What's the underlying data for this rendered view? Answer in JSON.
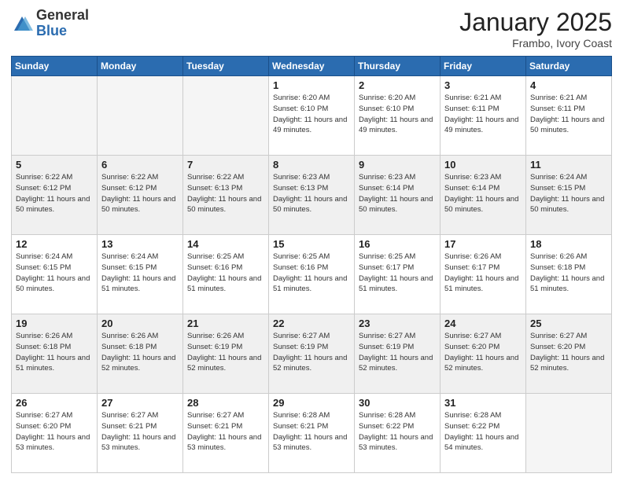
{
  "logo": {
    "general": "General",
    "blue": "Blue"
  },
  "header": {
    "month": "January 2025",
    "location": "Frambo, Ivory Coast"
  },
  "weekdays": [
    "Sunday",
    "Monday",
    "Tuesday",
    "Wednesday",
    "Thursday",
    "Friday",
    "Saturday"
  ],
  "weeks": [
    [
      {
        "day": "",
        "empty": true
      },
      {
        "day": "",
        "empty": true
      },
      {
        "day": "",
        "empty": true
      },
      {
        "day": "1",
        "sunrise": "6:20 AM",
        "sunset": "6:10 PM",
        "daylight": "11 hours and 49 minutes."
      },
      {
        "day": "2",
        "sunrise": "6:20 AM",
        "sunset": "6:10 PM",
        "daylight": "11 hours and 49 minutes."
      },
      {
        "day": "3",
        "sunrise": "6:21 AM",
        "sunset": "6:11 PM",
        "daylight": "11 hours and 49 minutes."
      },
      {
        "day": "4",
        "sunrise": "6:21 AM",
        "sunset": "6:11 PM",
        "daylight": "11 hours and 50 minutes."
      }
    ],
    [
      {
        "day": "5",
        "sunrise": "6:22 AM",
        "sunset": "6:12 PM",
        "daylight": "11 hours and 50 minutes."
      },
      {
        "day": "6",
        "sunrise": "6:22 AM",
        "sunset": "6:12 PM",
        "daylight": "11 hours and 50 minutes."
      },
      {
        "day": "7",
        "sunrise": "6:22 AM",
        "sunset": "6:13 PM",
        "daylight": "11 hours and 50 minutes."
      },
      {
        "day": "8",
        "sunrise": "6:23 AM",
        "sunset": "6:13 PM",
        "daylight": "11 hours and 50 minutes."
      },
      {
        "day": "9",
        "sunrise": "6:23 AM",
        "sunset": "6:14 PM",
        "daylight": "11 hours and 50 minutes."
      },
      {
        "day": "10",
        "sunrise": "6:23 AM",
        "sunset": "6:14 PM",
        "daylight": "11 hours and 50 minutes."
      },
      {
        "day": "11",
        "sunrise": "6:24 AM",
        "sunset": "6:15 PM",
        "daylight": "11 hours and 50 minutes."
      }
    ],
    [
      {
        "day": "12",
        "sunrise": "6:24 AM",
        "sunset": "6:15 PM",
        "daylight": "11 hours and 50 minutes."
      },
      {
        "day": "13",
        "sunrise": "6:24 AM",
        "sunset": "6:15 PM",
        "daylight": "11 hours and 51 minutes."
      },
      {
        "day": "14",
        "sunrise": "6:25 AM",
        "sunset": "6:16 PM",
        "daylight": "11 hours and 51 minutes."
      },
      {
        "day": "15",
        "sunrise": "6:25 AM",
        "sunset": "6:16 PM",
        "daylight": "11 hours and 51 minutes."
      },
      {
        "day": "16",
        "sunrise": "6:25 AM",
        "sunset": "6:17 PM",
        "daylight": "11 hours and 51 minutes."
      },
      {
        "day": "17",
        "sunrise": "6:26 AM",
        "sunset": "6:17 PM",
        "daylight": "11 hours and 51 minutes."
      },
      {
        "day": "18",
        "sunrise": "6:26 AM",
        "sunset": "6:18 PM",
        "daylight": "11 hours and 51 minutes."
      }
    ],
    [
      {
        "day": "19",
        "sunrise": "6:26 AM",
        "sunset": "6:18 PM",
        "daylight": "11 hours and 51 minutes."
      },
      {
        "day": "20",
        "sunrise": "6:26 AM",
        "sunset": "6:18 PM",
        "daylight": "11 hours and 52 minutes."
      },
      {
        "day": "21",
        "sunrise": "6:26 AM",
        "sunset": "6:19 PM",
        "daylight": "11 hours and 52 minutes."
      },
      {
        "day": "22",
        "sunrise": "6:27 AM",
        "sunset": "6:19 PM",
        "daylight": "11 hours and 52 minutes."
      },
      {
        "day": "23",
        "sunrise": "6:27 AM",
        "sunset": "6:19 PM",
        "daylight": "11 hours and 52 minutes."
      },
      {
        "day": "24",
        "sunrise": "6:27 AM",
        "sunset": "6:20 PM",
        "daylight": "11 hours and 52 minutes."
      },
      {
        "day": "25",
        "sunrise": "6:27 AM",
        "sunset": "6:20 PM",
        "daylight": "11 hours and 52 minutes."
      }
    ],
    [
      {
        "day": "26",
        "sunrise": "6:27 AM",
        "sunset": "6:20 PM",
        "daylight": "11 hours and 53 minutes."
      },
      {
        "day": "27",
        "sunrise": "6:27 AM",
        "sunset": "6:21 PM",
        "daylight": "11 hours and 53 minutes."
      },
      {
        "day": "28",
        "sunrise": "6:27 AM",
        "sunset": "6:21 PM",
        "daylight": "11 hours and 53 minutes."
      },
      {
        "day": "29",
        "sunrise": "6:28 AM",
        "sunset": "6:21 PM",
        "daylight": "11 hours and 53 minutes."
      },
      {
        "day": "30",
        "sunrise": "6:28 AM",
        "sunset": "6:22 PM",
        "daylight": "11 hours and 53 minutes."
      },
      {
        "day": "31",
        "sunrise": "6:28 AM",
        "sunset": "6:22 PM",
        "daylight": "11 hours and 54 minutes."
      },
      {
        "day": "",
        "empty": true
      }
    ]
  ]
}
